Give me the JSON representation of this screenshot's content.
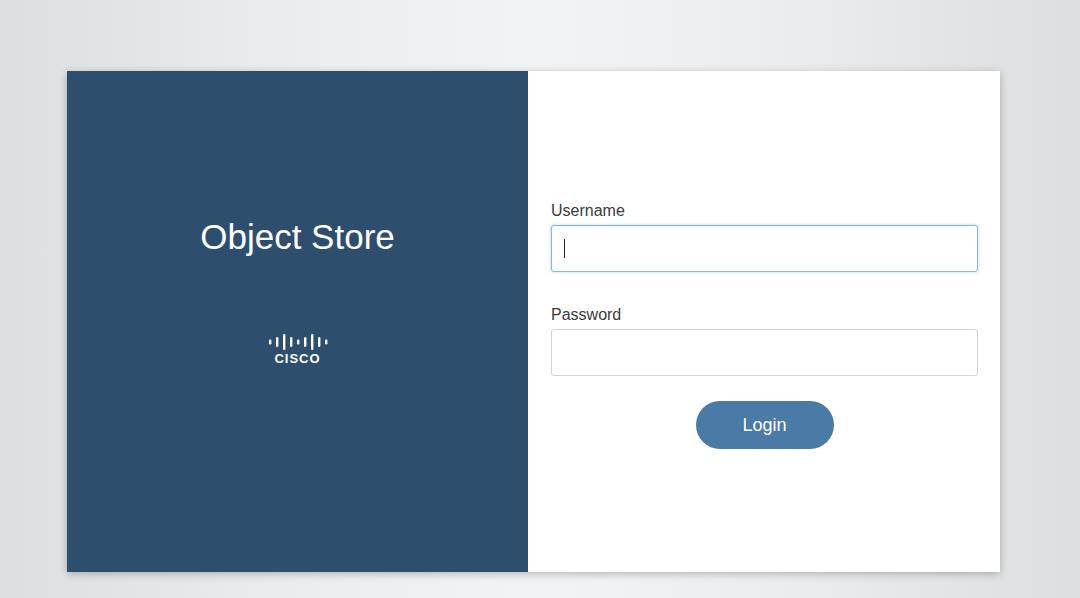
{
  "app": {
    "title": "Object Store",
    "logo": "CISCO"
  },
  "form": {
    "fields": [
      {
        "label": "Username",
        "value": "",
        "focused": true
      },
      {
        "label": "Password",
        "value": "",
        "focused": false
      }
    ],
    "buttons": [
      "Login"
    ]
  }
}
